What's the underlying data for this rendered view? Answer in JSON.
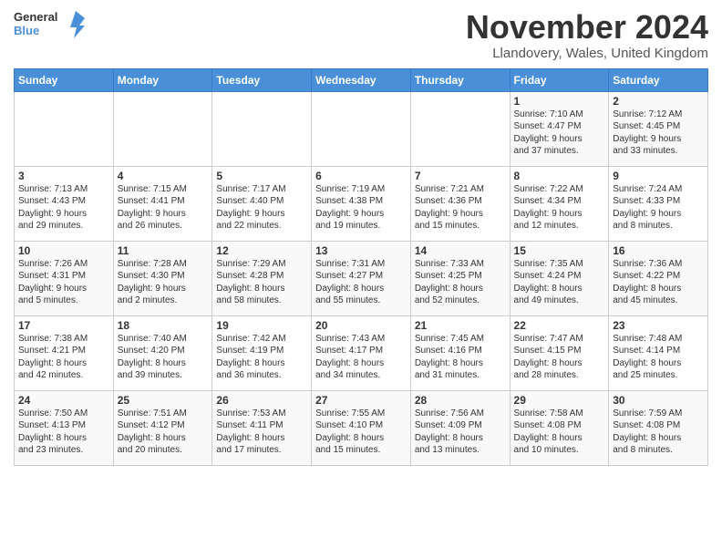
{
  "header": {
    "logo_general": "General",
    "logo_blue": "Blue",
    "month_title": "November 2024",
    "location": "Llandovery, Wales, United Kingdom"
  },
  "weekdays": [
    "Sunday",
    "Monday",
    "Tuesday",
    "Wednesday",
    "Thursday",
    "Friday",
    "Saturday"
  ],
  "weeks": [
    [
      {
        "day": "",
        "info": ""
      },
      {
        "day": "",
        "info": ""
      },
      {
        "day": "",
        "info": ""
      },
      {
        "day": "",
        "info": ""
      },
      {
        "day": "",
        "info": ""
      },
      {
        "day": "1",
        "info": "Sunrise: 7:10 AM\nSunset: 4:47 PM\nDaylight: 9 hours\nand 37 minutes."
      },
      {
        "day": "2",
        "info": "Sunrise: 7:12 AM\nSunset: 4:45 PM\nDaylight: 9 hours\nand 33 minutes."
      }
    ],
    [
      {
        "day": "3",
        "info": "Sunrise: 7:13 AM\nSunset: 4:43 PM\nDaylight: 9 hours\nand 29 minutes."
      },
      {
        "day": "4",
        "info": "Sunrise: 7:15 AM\nSunset: 4:41 PM\nDaylight: 9 hours\nand 26 minutes."
      },
      {
        "day": "5",
        "info": "Sunrise: 7:17 AM\nSunset: 4:40 PM\nDaylight: 9 hours\nand 22 minutes."
      },
      {
        "day": "6",
        "info": "Sunrise: 7:19 AM\nSunset: 4:38 PM\nDaylight: 9 hours\nand 19 minutes."
      },
      {
        "day": "7",
        "info": "Sunrise: 7:21 AM\nSunset: 4:36 PM\nDaylight: 9 hours\nand 15 minutes."
      },
      {
        "day": "8",
        "info": "Sunrise: 7:22 AM\nSunset: 4:34 PM\nDaylight: 9 hours\nand 12 minutes."
      },
      {
        "day": "9",
        "info": "Sunrise: 7:24 AM\nSunset: 4:33 PM\nDaylight: 9 hours\nand 8 minutes."
      }
    ],
    [
      {
        "day": "10",
        "info": "Sunrise: 7:26 AM\nSunset: 4:31 PM\nDaylight: 9 hours\nand 5 minutes."
      },
      {
        "day": "11",
        "info": "Sunrise: 7:28 AM\nSunset: 4:30 PM\nDaylight: 9 hours\nand 2 minutes."
      },
      {
        "day": "12",
        "info": "Sunrise: 7:29 AM\nSunset: 4:28 PM\nDaylight: 8 hours\nand 58 minutes."
      },
      {
        "day": "13",
        "info": "Sunrise: 7:31 AM\nSunset: 4:27 PM\nDaylight: 8 hours\nand 55 minutes."
      },
      {
        "day": "14",
        "info": "Sunrise: 7:33 AM\nSunset: 4:25 PM\nDaylight: 8 hours\nand 52 minutes."
      },
      {
        "day": "15",
        "info": "Sunrise: 7:35 AM\nSunset: 4:24 PM\nDaylight: 8 hours\nand 49 minutes."
      },
      {
        "day": "16",
        "info": "Sunrise: 7:36 AM\nSunset: 4:22 PM\nDaylight: 8 hours\nand 45 minutes."
      }
    ],
    [
      {
        "day": "17",
        "info": "Sunrise: 7:38 AM\nSunset: 4:21 PM\nDaylight: 8 hours\nand 42 minutes."
      },
      {
        "day": "18",
        "info": "Sunrise: 7:40 AM\nSunset: 4:20 PM\nDaylight: 8 hours\nand 39 minutes."
      },
      {
        "day": "19",
        "info": "Sunrise: 7:42 AM\nSunset: 4:19 PM\nDaylight: 8 hours\nand 36 minutes."
      },
      {
        "day": "20",
        "info": "Sunrise: 7:43 AM\nSunset: 4:17 PM\nDaylight: 8 hours\nand 34 minutes."
      },
      {
        "day": "21",
        "info": "Sunrise: 7:45 AM\nSunset: 4:16 PM\nDaylight: 8 hours\nand 31 minutes."
      },
      {
        "day": "22",
        "info": "Sunrise: 7:47 AM\nSunset: 4:15 PM\nDaylight: 8 hours\nand 28 minutes."
      },
      {
        "day": "23",
        "info": "Sunrise: 7:48 AM\nSunset: 4:14 PM\nDaylight: 8 hours\nand 25 minutes."
      }
    ],
    [
      {
        "day": "24",
        "info": "Sunrise: 7:50 AM\nSunset: 4:13 PM\nDaylight: 8 hours\nand 23 minutes."
      },
      {
        "day": "25",
        "info": "Sunrise: 7:51 AM\nSunset: 4:12 PM\nDaylight: 8 hours\nand 20 minutes."
      },
      {
        "day": "26",
        "info": "Sunrise: 7:53 AM\nSunset: 4:11 PM\nDaylight: 8 hours\nand 17 minutes."
      },
      {
        "day": "27",
        "info": "Sunrise: 7:55 AM\nSunset: 4:10 PM\nDaylight: 8 hours\nand 15 minutes."
      },
      {
        "day": "28",
        "info": "Sunrise: 7:56 AM\nSunset: 4:09 PM\nDaylight: 8 hours\nand 13 minutes."
      },
      {
        "day": "29",
        "info": "Sunrise: 7:58 AM\nSunset: 4:08 PM\nDaylight: 8 hours\nand 10 minutes."
      },
      {
        "day": "30",
        "info": "Sunrise: 7:59 AM\nSunset: 4:08 PM\nDaylight: 8 hours\nand 8 minutes."
      }
    ]
  ]
}
